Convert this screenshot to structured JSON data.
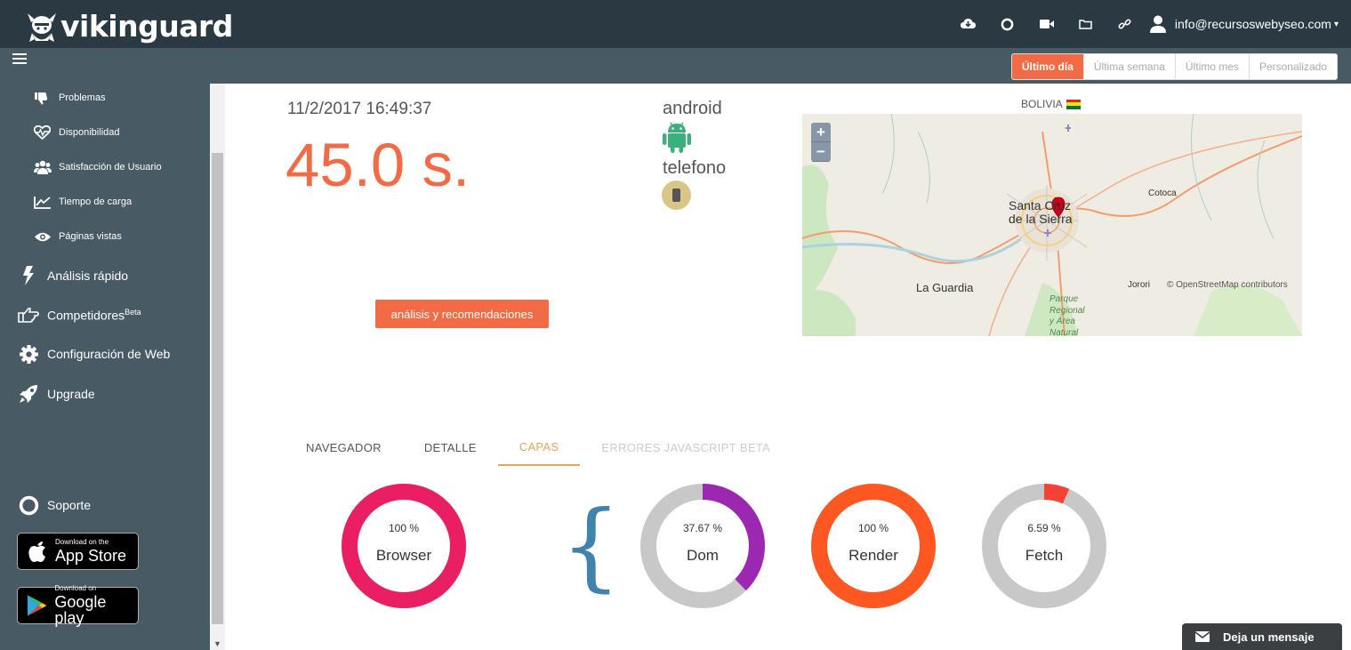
{
  "brand": {
    "name": "vikinguard"
  },
  "header": {
    "icons": [
      "cloud-download-icon",
      "life-ring-icon",
      "video-icon",
      "folder-icon",
      "link-icon"
    ],
    "user_email": "info@recursoswebyseo.com"
  },
  "range": {
    "options": [
      "Último día",
      "Última semana",
      "Último mes",
      "Personalizado"
    ],
    "active": "Último día"
  },
  "sidebar": {
    "sub_items": [
      {
        "label": "Problemas",
        "icon": "thumbs-down-icon"
      },
      {
        "label": "Disponibilidad",
        "icon": "heartbeat-icon"
      },
      {
        "label": "Satisfacción de Usuario",
        "icon": "users-icon"
      },
      {
        "label": "Tiempo de carga",
        "icon": "line-chart-icon"
      },
      {
        "label": "Páginas vistas",
        "icon": "eye-icon"
      }
    ],
    "main_items": [
      {
        "label": "Análisis rápido",
        "icon": "bolt-icon"
      },
      {
        "label": "Competidores",
        "sup": "Beta",
        "icon": "hand-pointer-icon"
      },
      {
        "label": "Configuración de Web",
        "icon": "gear-icon"
      },
      {
        "label": "Upgrade",
        "icon": "rocket-icon"
      }
    ],
    "support": "Soporte",
    "app_store": {
      "small": "Download on the",
      "big": "App Store"
    },
    "google_play": {
      "small": "Download on",
      "big": "Google play"
    }
  },
  "detail": {
    "timestamp": "11/2/2017 16:49:37",
    "load_time": "45.0 s.",
    "analysis_button": "análisis y recomendaciones",
    "os": "android",
    "device": "telefono",
    "country": "BOLIVIA"
  },
  "map": {
    "zoom_in": "+",
    "zoom_out": "−",
    "labels": {
      "city": "Santa Cruz de la Sierra",
      "cotoca": "Cotoca",
      "guardia": "La Guardia",
      "jorori": "Jorori",
      "park": "Parque Regional y Área Natural"
    },
    "attribution": "© OpenStreetMap contributors"
  },
  "tabs": {
    "items": [
      "NAVEGADOR",
      "DETALLE",
      "CAPAS",
      "ERRORES JAVASCRIPT"
    ],
    "beta": "BETA",
    "active": "CAPAS"
  },
  "layers": [
    {
      "name": "Browser",
      "pct_label": "100 %",
      "pct": 100,
      "color": "#e91e63"
    },
    {
      "name": "Dom",
      "pct_label": "37.67 %",
      "pct": 37.67,
      "color": "#9c27b0"
    },
    {
      "name": "Render",
      "pct_label": "100 %",
      "pct": 100,
      "color": "#ff5722"
    },
    {
      "name": "Fetch",
      "pct_label": "6.59 %",
      "pct": 6.59,
      "color": "#f44336"
    }
  ],
  "brace": "{",
  "message_widget": {
    "label": "Deja un mensaje"
  }
}
